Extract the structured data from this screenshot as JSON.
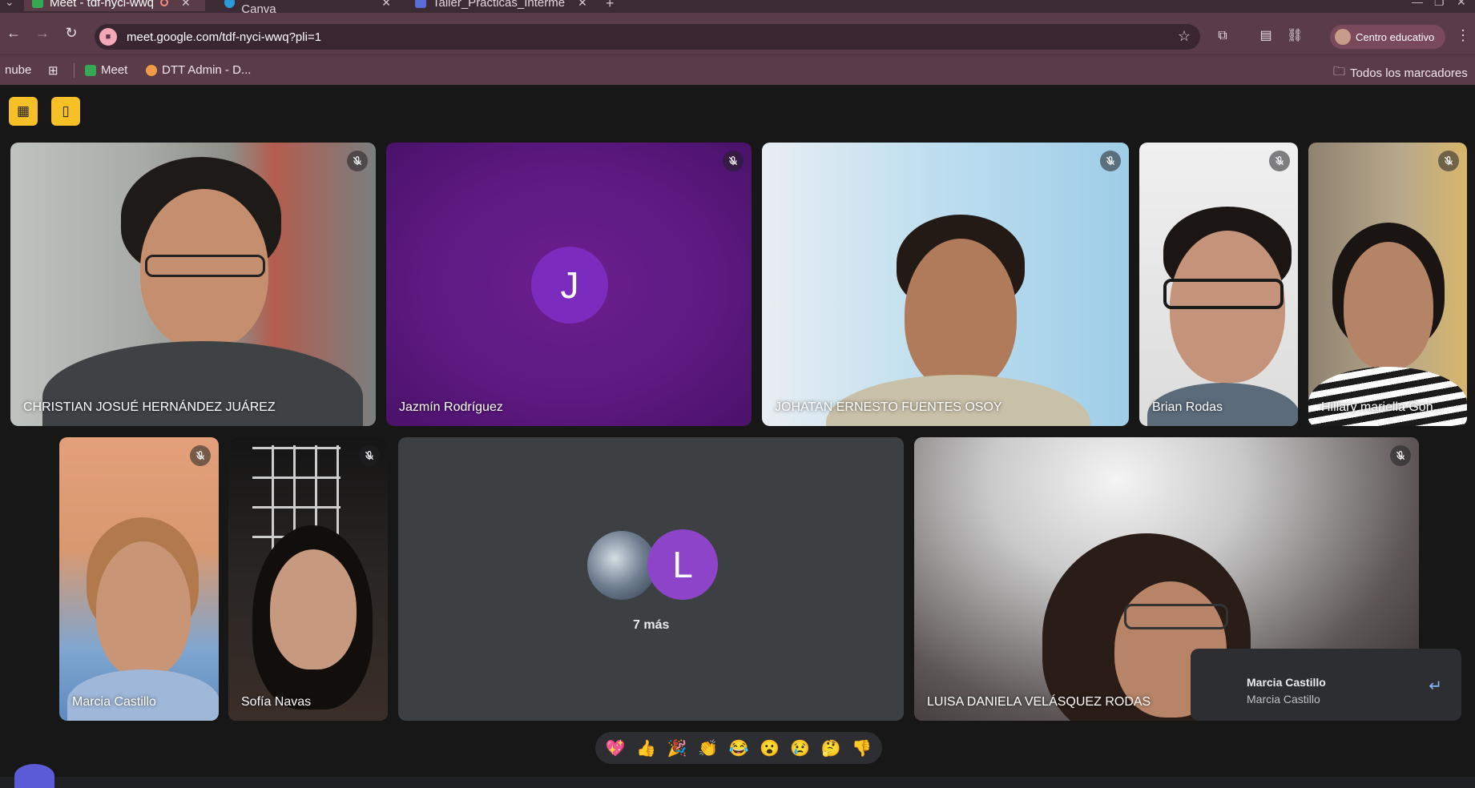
{
  "browser": {
    "tabs": [
      {
        "label": "Meet - tdf-nyci-wwq",
        "active": true
      },
      {
        "label": "Inicio - Canva",
        "active": false
      },
      {
        "label": "Taller_Practicas_Interme",
        "active": false
      }
    ],
    "new_tab": "+",
    "url": "meet.google.com/tdf-nyci-wwq?pli=1",
    "profile_label": "Centro educativo",
    "bookmarks": [
      {
        "label": "nube"
      },
      {
        "label": "Meet"
      },
      {
        "label": "DTT Admin - D..."
      }
    ],
    "all_bookmarks": "Todos los marcadores"
  },
  "meet": {
    "tiles": [
      {
        "name": "CHRISTIAN JOSUÉ HERNÁNDEZ JUÁREZ"
      },
      {
        "name": "Jazmín Rodríguez",
        "avatar_letter": "J"
      },
      {
        "name": "JOHATAN ERNESTO FUENTES OSOY"
      },
      {
        "name": "Brian Rodas"
      },
      {
        "name": "Hillary mariella Gon..."
      },
      {
        "name": "Marcia Castillo"
      },
      {
        "name": "Sofía Navas"
      },
      {
        "name": "LUISA DANIELA VELÁSQUEZ RODAS"
      }
    ],
    "others": {
      "avatar_letter": "L",
      "label": "7 más"
    },
    "reactions": [
      "💖",
      "👍",
      "🎉",
      "👏",
      "😂",
      "😮",
      "😢",
      "🤔",
      "👎"
    ],
    "notification": {
      "title": "Marcia Castillo",
      "subtitle": "Marcia Castillo"
    },
    "colors": {
      "accent_yellow": "#f6c026",
      "jazmin_bg": "#5e1a82",
      "avatar_purple": "#7b2cbf",
      "avatar_L": "#8e44c9"
    }
  }
}
